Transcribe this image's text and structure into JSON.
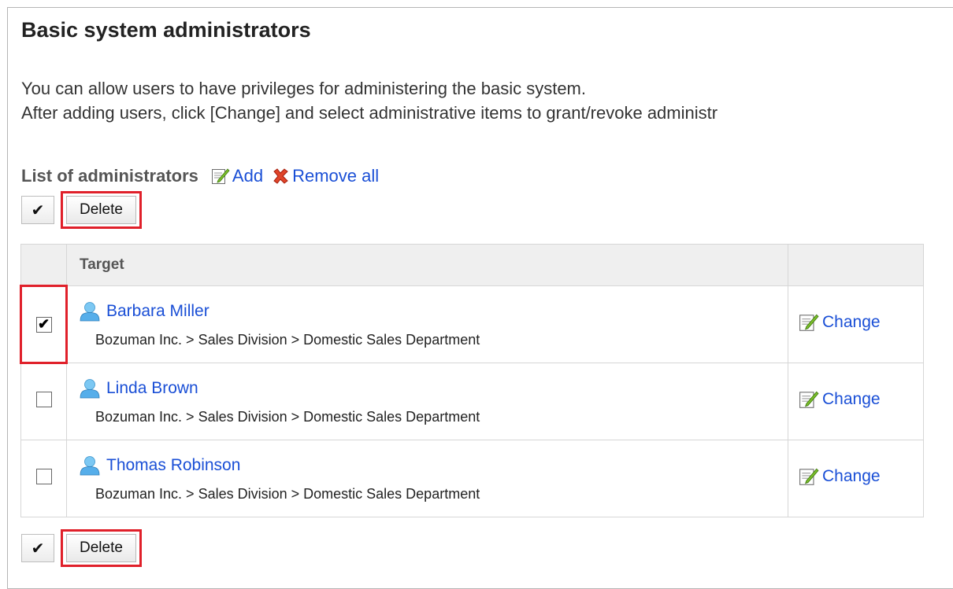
{
  "page": {
    "title": "Basic system administrators",
    "desc_line1": "You can allow users to have privileges for administering the basic system.",
    "desc_line2": "After adding users, click [Change] and select administrative items to grant/revoke administr"
  },
  "list": {
    "label": "List of administrators",
    "add_label": "Add",
    "remove_all_label": "Remove all"
  },
  "toolbar": {
    "check_all_symbol": "✔",
    "delete_label": "Delete"
  },
  "table": {
    "header_target": "Target",
    "change_label": "Change",
    "rows": [
      {
        "name": "Barbara Miller",
        "path": "Bozuman Inc. > Sales Division > Domestic Sales Department",
        "checked": "✔"
      },
      {
        "name": "Linda Brown",
        "path": "Bozuman Inc. > Sales Division > Domestic Sales Department",
        "checked": ""
      },
      {
        "name": "Thomas Robinson",
        "path": "Bozuman Inc. > Sales Division > Domestic Sales Department",
        "checked": ""
      }
    ]
  },
  "colors": {
    "link": "#1a4fd6",
    "highlight": "#e0202a",
    "header_bg": "#efefef"
  },
  "icons": {
    "add": "edit-icon",
    "remove_all": "red-x-icon",
    "user": "user-icon",
    "change": "edit-icon"
  }
}
